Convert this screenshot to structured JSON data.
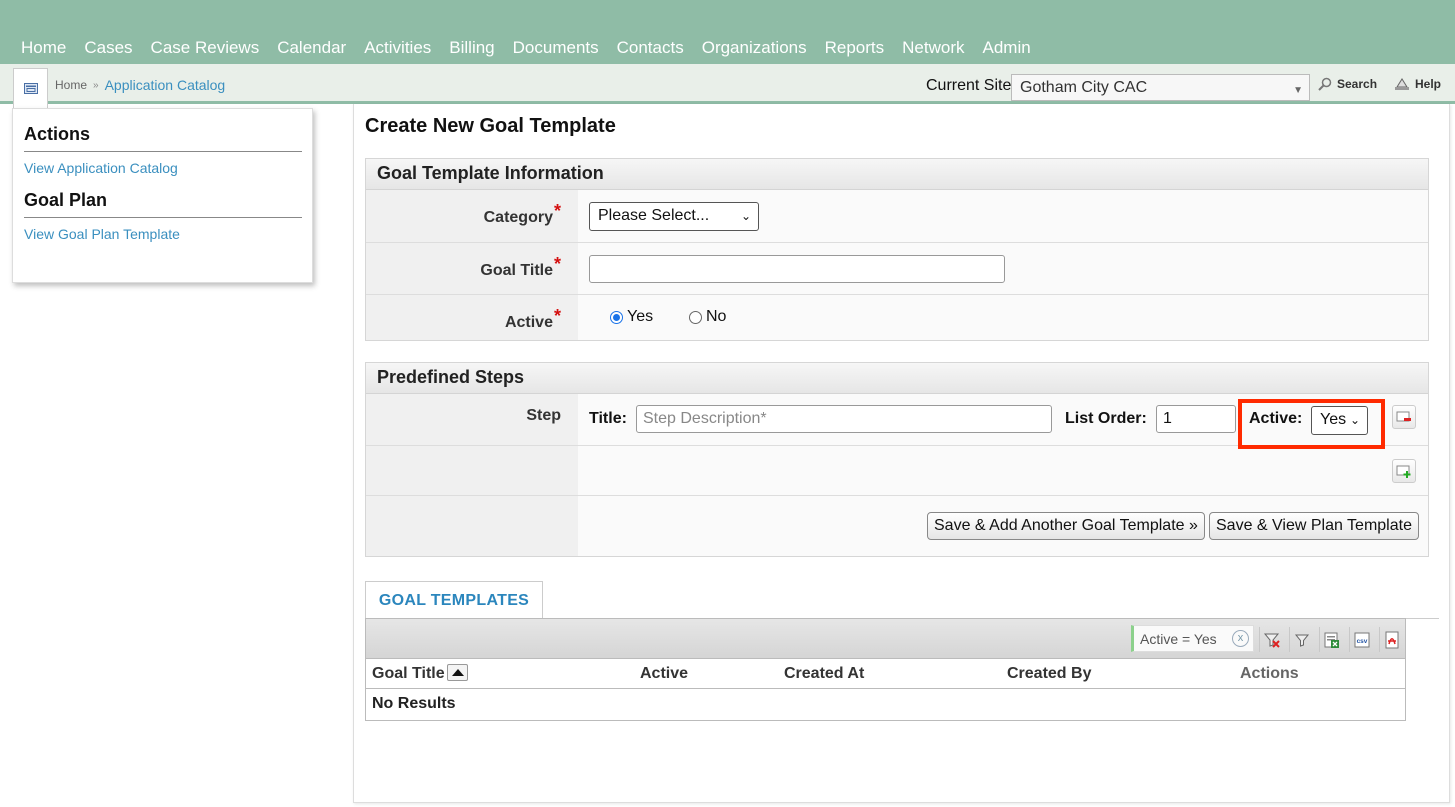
{
  "nav": {
    "items": [
      "Home",
      "Cases",
      "Case Reviews",
      "Calendar",
      "Activities",
      "Billing",
      "Documents",
      "Contacts",
      "Organizations",
      "Reports",
      "Network",
      "Admin"
    ]
  },
  "breadcrumb": {
    "home": "Home",
    "separator": "»",
    "current": "Application Catalog"
  },
  "site": {
    "label": "Current Site",
    "value": "Gotham City CAC"
  },
  "tools": {
    "search": "Search",
    "help": "Help"
  },
  "sidebar": {
    "sections": [
      {
        "title": "Actions",
        "links": [
          "View Application Catalog"
        ]
      },
      {
        "title": "Goal Plan",
        "links": [
          "View Goal Plan Template"
        ]
      }
    ]
  },
  "page": {
    "title": "Create New Goal Template"
  },
  "goal_info": {
    "heading": "Goal Template Information",
    "category_label": "Category",
    "category_value": "Please Select...",
    "goal_title_label": "Goal Title",
    "goal_title_value": "",
    "active_label": "Active",
    "active_yes": "Yes",
    "active_no": "No",
    "active_selected": "Yes",
    "required_mark": "*"
  },
  "steps": {
    "heading": "Predefined Steps",
    "step_label": "Step",
    "title_label": "Title:",
    "title_placeholder": "Step Description*",
    "list_order_label": "List Order:",
    "list_order_value": "1",
    "active_label": "Active:",
    "active_value": "Yes",
    "remove_icon": "remove-step-icon",
    "add_icon": "add-step-icon"
  },
  "buttons": {
    "save_add": "Save & Add Another Goal Template »",
    "save_view": "Save & View Plan Template"
  },
  "grid": {
    "tab_label": "GOAL TEMPLATES",
    "filter_chip": "Active = Yes",
    "filter_chip_close": "x",
    "columns": [
      "Goal Title",
      "Active",
      "Created At",
      "Created By",
      "Actions"
    ],
    "empty_text": "No Results",
    "export_csv_label": "csv"
  },
  "colors": {
    "nav_bg": "#8fbca6",
    "link": "#3a8fbf",
    "required": "#d41010",
    "highlight": "#ff2a00"
  }
}
